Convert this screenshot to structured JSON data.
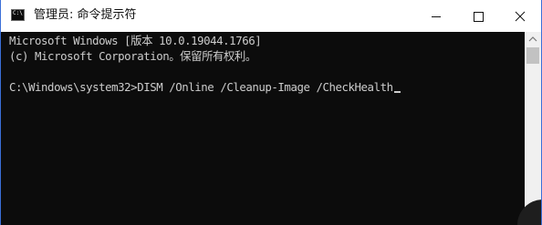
{
  "window": {
    "title": "管理员: 命令提示符",
    "icon": "cmd-icon",
    "icon_glyph": "C:\\"
  },
  "controls": {
    "minimize": "minimize-icon",
    "maximize": "maximize-icon",
    "close": "close-icon"
  },
  "console": {
    "lines": [
      "Microsoft Windows [版本 10.0.19044.1766]",
      "(c) Microsoft Corporation。保留所有权利。"
    ],
    "prompt": "C:\\Windows\\system32>",
    "command": "DISM /Online /Cleanup-Image /CheckHealth"
  },
  "colors": {
    "console_background": "#0c0c0c",
    "console_text": "#cccccc",
    "title_background": "#ffffff",
    "window_border": "#3a6fd8"
  }
}
